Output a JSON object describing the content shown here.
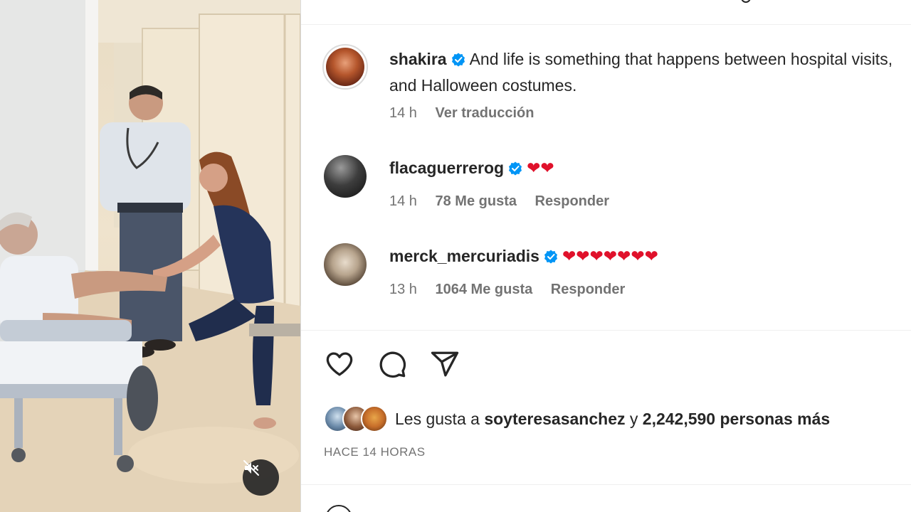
{
  "post": {
    "caption": {
      "username": "shakira",
      "text": "And life is something that happens between hospital visits, and Halloween costumes.",
      "time": "14 h",
      "translate_label": "Ver traducción"
    },
    "comments": [
      {
        "username": "flacaguerrerog",
        "hearts": "❤❤",
        "time": "14 h",
        "likes": "78 Me gusta",
        "reply_label": "Responder"
      },
      {
        "username": "merck_mercuriadis",
        "hearts": "❤❤❤❤❤❤❤",
        "time": "13 h",
        "likes": "1064 Me gusta",
        "reply_label": "Responder"
      }
    ],
    "likes_summary": {
      "prefix": "Les gusta a",
      "user": "soyteresasanchez",
      "connector": "y",
      "count_text": "2,242,590 personas más"
    },
    "posted_ago": "HACE 14 HORAS"
  },
  "colors": {
    "verified_blue": "#0095f6",
    "heart_red": "#e0112b",
    "text_primary": "#262626",
    "text_secondary": "#737373"
  },
  "icons": [
    "volume-off-icon",
    "verified-badge-icon",
    "like-icon",
    "comment-icon",
    "share-icon",
    "heart-emoji-icon"
  ]
}
